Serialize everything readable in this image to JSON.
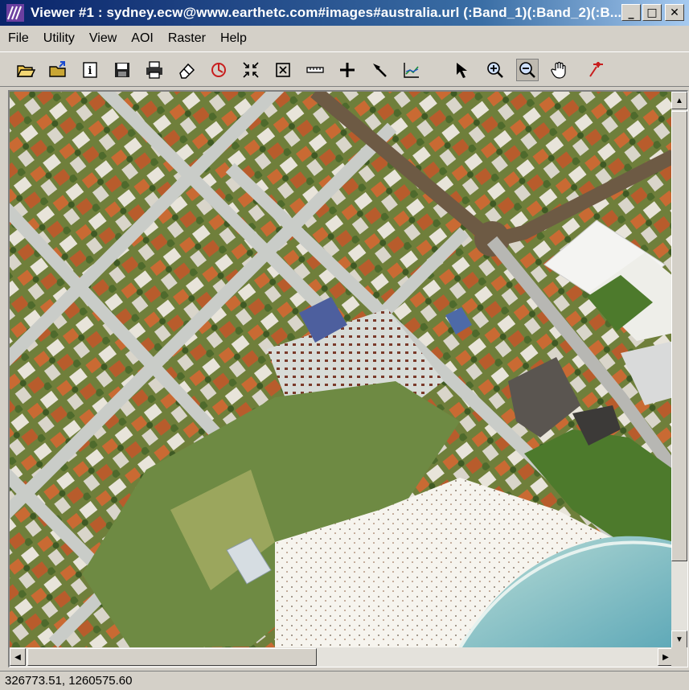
{
  "window": {
    "title": "Viewer #1 : sydney.ecw@www.earthetc.com#images#australia.url (:Band_1)(:Band_2)(:B...",
    "minimize_glyph": "_",
    "maximize_glyph": "□",
    "close_glyph": "✕"
  },
  "menu": [
    {
      "label": "File"
    },
    {
      "label": "Utility"
    },
    {
      "label": "View"
    },
    {
      "label": "AOI"
    },
    {
      "label": "Raster"
    },
    {
      "label": "Help"
    }
  ],
  "toolbar": {
    "icons": [
      "open-folder-icon",
      "open-layer-icon",
      "info-icon",
      "save-icon",
      "print-icon",
      "eraser-icon",
      "rotate-icon",
      "zoom-to-data-icon",
      "fit-window-icon",
      "measure-icon",
      "crosshair-icon",
      "pick-icon",
      "profile-icon",
      "select-arrow-icon",
      "zoom-in-icon",
      "zoom-out-icon",
      "pan-hand-icon",
      "pin-icon"
    ]
  },
  "scroll": {
    "up_arrow": "▲",
    "down_arrow": "▼",
    "left_arrow": "◀",
    "right_arrow": "▶"
  },
  "status": {
    "coordinates": "326773.51, 1260575.60"
  },
  "colors": {
    "title_start": "#0a246a",
    "title_end": "#a6caf0",
    "chrome": "#d4d0c8",
    "ocean": "#7fbfc9",
    "sand": "#f4f1ea",
    "vegetation": "#6f7f3b"
  }
}
